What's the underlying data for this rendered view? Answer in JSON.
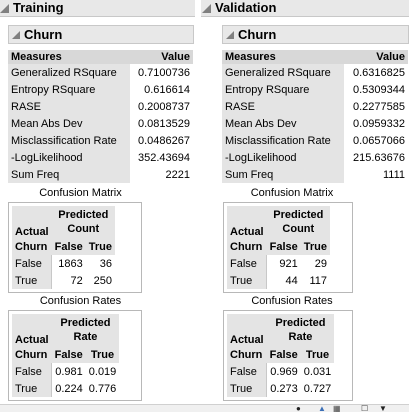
{
  "training": {
    "title": "Training",
    "subtitle": "Churn",
    "measures": {
      "col_name": "Measures",
      "col_value": "Value",
      "rows": [
        {
          "name": "Generalized RSquare",
          "value": "0.7100736"
        },
        {
          "name": "Entropy RSquare",
          "value": "0.616614"
        },
        {
          "name": "RASE",
          "value": "0.2008737"
        },
        {
          "name": "Mean Abs Dev",
          "value": "0.0813529"
        },
        {
          "name": "Misclassification Rate",
          "value": "0.0486267"
        },
        {
          "name": "-LogLikelihood",
          "value": "352.43694"
        },
        {
          "name": "Sum Freq",
          "value": "2221"
        }
      ]
    },
    "confusion_matrix": {
      "title": "Confusion Matrix",
      "predicted_label": "Predicted",
      "stat_label": "Count",
      "actual_label": "Actual",
      "churn_label": "Churn",
      "col_false": "False",
      "col_true": "True",
      "rows": [
        {
          "label": "False",
          "false": "1863",
          "true": "36"
        },
        {
          "label": "True",
          "false": "72",
          "true": "250"
        }
      ]
    },
    "confusion_rates": {
      "title": "Confusion Rates",
      "predicted_label": "Predicted",
      "stat_label": "Rate",
      "actual_label": "Actual",
      "churn_label": "Churn",
      "col_false": "False",
      "col_true": "True",
      "rows": [
        {
          "label": "False",
          "false": "0.981",
          "true": "0.019"
        },
        {
          "label": "True",
          "false": "0.224",
          "true": "0.776"
        }
      ]
    }
  },
  "validation": {
    "title": "Validation",
    "subtitle": "Churn",
    "measures": {
      "col_name": "Measures",
      "col_value": "Value",
      "rows": [
        {
          "name": "Generalized RSquare",
          "value": "0.6316825"
        },
        {
          "name": "Entropy RSquare",
          "value": "0.5309344"
        },
        {
          "name": "RASE",
          "value": "0.2277585"
        },
        {
          "name": "Mean Abs Dev",
          "value": "0.0959332"
        },
        {
          "name": "Misclassification Rate",
          "value": "0.0657066"
        },
        {
          "name": "-LogLikelihood",
          "value": "215.63676"
        },
        {
          "name": "Sum Freq",
          "value": "1111"
        }
      ]
    },
    "confusion_matrix": {
      "title": "Confusion Matrix",
      "predicted_label": "Predicted",
      "stat_label": "Count",
      "actual_label": "Actual",
      "churn_label": "Churn",
      "col_false": "False",
      "col_true": "True",
      "rows": [
        {
          "label": "False",
          "false": "921",
          "true": "29"
        },
        {
          "label": "True",
          "false": "44",
          "true": "117"
        }
      ]
    },
    "confusion_rates": {
      "title": "Confusion Rates",
      "predicted_label": "Predicted",
      "stat_label": "Rate",
      "actual_label": "Actual",
      "churn_label": "Churn",
      "col_false": "False",
      "col_true": "True",
      "rows": [
        {
          "label": "False",
          "false": "0.969",
          "true": "0.031"
        },
        {
          "label": "True",
          "false": "0.273",
          "true": "0.727"
        }
      ]
    }
  },
  "statusbar": {
    "icons": [
      "info-icon",
      "home-icon",
      "table-icon",
      "checkbox-icon",
      "dropdown-icon"
    ]
  }
}
